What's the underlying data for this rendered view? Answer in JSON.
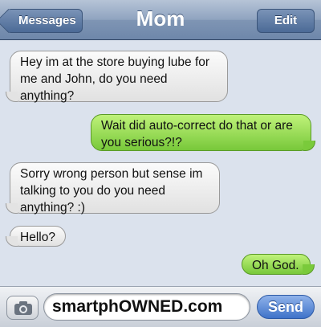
{
  "navbar": {
    "back_label": "Messages",
    "title": "Mom",
    "edit_label": "Edit"
  },
  "messages": [
    {
      "direction": "incoming",
      "text": "Hey im at the store buying lube for me and John, do you need anything?"
    },
    {
      "direction": "outgoing",
      "text": "Wait did auto-correct do that or are you serious?!?"
    },
    {
      "direction": "incoming",
      "text": "Sorry wrong person but sense im talking to you do you need anything? :)"
    },
    {
      "direction": "incoming",
      "text": "Hello?"
    },
    {
      "direction": "outgoing",
      "text": "Oh God."
    }
  ],
  "input_bar": {
    "camera_icon": "camera-icon",
    "text_value": "smartphOWNED.com",
    "send_label": "Send"
  },
  "colors": {
    "incoming_bubble": "#e8e8e8",
    "outgoing_bubble": "#8fd44a",
    "navbar": "#7f95b4",
    "send_button": "#3f73c9"
  }
}
